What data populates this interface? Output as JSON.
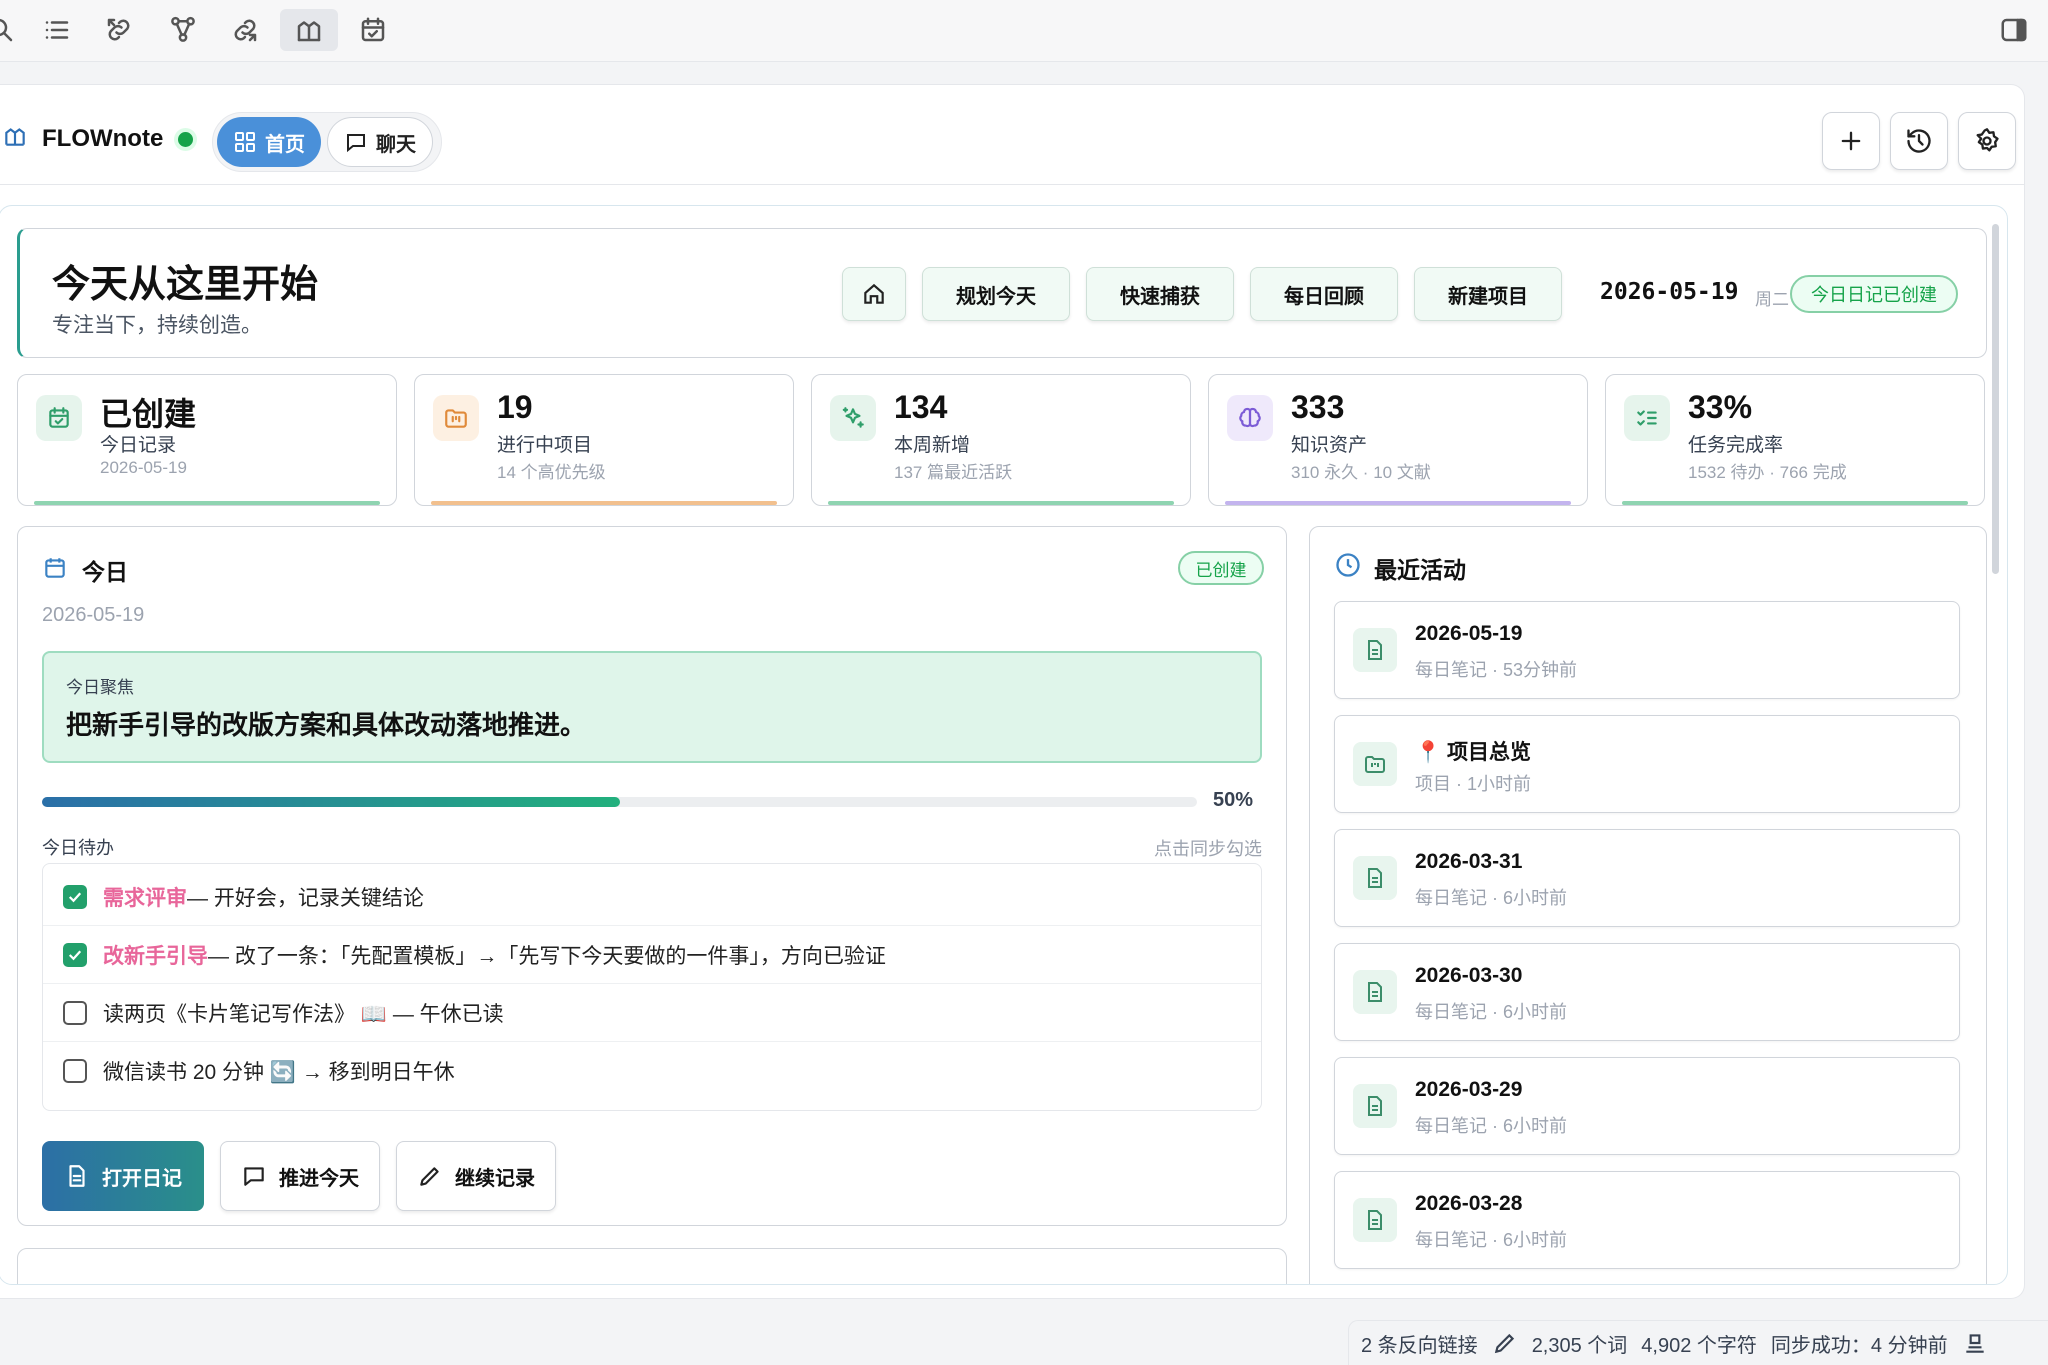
{
  "app": {
    "name": "FLOWnote"
  },
  "tabs": {
    "home": "首页",
    "chat": "聊天"
  },
  "hero": {
    "title": "今天从这里开始",
    "subtitle": "专注当下，持续创造。",
    "buttons": [
      "规划今天",
      "快速捕获",
      "每日回顾",
      "新建项目"
    ],
    "date": "2026-05-19",
    "weekday": "周二",
    "diary_status": "今日日记已创建"
  },
  "stats": [
    {
      "value": "已创建",
      "label": "今日记录",
      "sub": "2026-05-19",
      "icon": "calendar-check-icon"
    },
    {
      "value": "19",
      "label": "进行中项目",
      "sub": "14 个高优先级",
      "icon": "folder-kanban-icon"
    },
    {
      "value": "134",
      "label": "本周新增",
      "sub": "137 篇最近活跃",
      "icon": "sparkles-icon"
    },
    {
      "value": "333",
      "label": "知识资产",
      "sub": "310 永久 · 10 文献",
      "icon": "brain-icon"
    },
    {
      "value": "33%",
      "label": "任务完成率",
      "sub": "1532 待办 · 766 完成",
      "icon": "list-checks-icon"
    }
  ],
  "today": {
    "title": "今日",
    "badge": "已创建",
    "date": "2026-05-19",
    "focus_label": "今日聚焦",
    "focus_text": "把新手引导的改版方案和具体改动落地推进。",
    "progress": 0.5,
    "progress_label": "50%",
    "todo_label": "今日待办",
    "todo_hint": "点击同步勾选",
    "todos": [
      {
        "done": true,
        "highlight": "需求评审",
        "text": " — 开好会，记录关键结论"
      },
      {
        "done": true,
        "highlight": "改新手引导",
        "text": " — 改了一条：「先配置模板」→「先写下今天要做的一件事」，方向已验证"
      },
      {
        "done": false,
        "highlight": "",
        "text": "读两页《卡片笔记写作法》 📖 — 午休已读"
      },
      {
        "done": false,
        "highlight": "",
        "text": "微信读书 20 分钟 🔄 → 移到明日午休"
      }
    ],
    "actions": [
      "打开日记",
      "推进今天",
      "继续记录"
    ]
  },
  "recent": {
    "title": "最近活动",
    "items": [
      {
        "title": "2026-05-19",
        "sub": "每日笔记 · 53分钟前",
        "icon": "file-text-icon"
      },
      {
        "title": "📍 项目总览",
        "sub": "项目 · 1小时前",
        "icon": "folder-kanban-icon"
      },
      {
        "title": "2026-03-31",
        "sub": "每日笔记 · 6小时前",
        "icon": "file-text-icon"
      },
      {
        "title": "2026-03-30",
        "sub": "每日笔记 · 6小时前",
        "icon": "file-text-icon"
      },
      {
        "title": "2026-03-29",
        "sub": "每日笔记 · 6小时前",
        "icon": "file-text-icon"
      },
      {
        "title": "2026-03-28",
        "sub": "每日笔记 · 6小时前",
        "icon": "file-text-icon"
      }
    ]
  },
  "statusbar": {
    "backlinks": "2 条反向链接",
    "words": "2,305 个词",
    "chars": "4,902 个字符",
    "sync": "同步成功：4 分钟前"
  },
  "colors": {
    "accent": "#4a90d9",
    "green": "#22a06b",
    "highlight": "#e8669a"
  }
}
